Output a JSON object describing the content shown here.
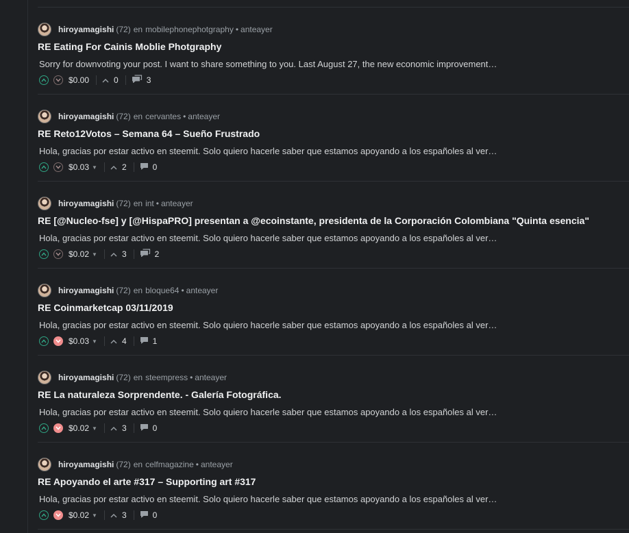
{
  "colors": {
    "background": "#1e2023",
    "upvote": "#2fa382",
    "downvote_active": "#f08d8d",
    "text": "#dfe1e3",
    "muted": "#9aa0a6"
  },
  "labels": {
    "in": "en",
    "dot": "•"
  },
  "posts": [
    {
      "author": "hiroyamagishi",
      "reputation": "(72)",
      "community": "mobilephonephotgraphy",
      "time": "anteayer",
      "title": "RE Eating For Cainis Moblie Photgraphy",
      "excerpt": "Sorry for downvoting your post. I want to share something to you. Last August 27, the new economic improvement…",
      "payout": "$0.00",
      "votes": "0",
      "comments": "3",
      "downvoted": false,
      "has_payout_caret": false,
      "comment_icon": "comments-icon"
    },
    {
      "author": "hiroyamagishi",
      "reputation": "(72)",
      "community": "cervantes",
      "time": "anteayer",
      "title": "RE Reto12Votos – Semana 64 – Sueño Frustrado",
      "excerpt": "Hola, gracias por estar activo en steemit. Solo quiero hacerle saber que estamos apoyando a los españoles al ver…",
      "payout": "$0.03",
      "votes": "2",
      "comments": "0",
      "downvoted": false,
      "has_payout_caret": true,
      "comment_icon": "comment-icon"
    },
    {
      "author": "hiroyamagishi",
      "reputation": "(72)",
      "community": "int",
      "time": "anteayer",
      "title": "RE [@Nucleo-fse] y [@HispaPRO] presentan a @ecoinstante, presidenta de la Corporación Colombiana \"Quinta esencia\"",
      "excerpt": "Hola, gracias por estar activo en steemit. Solo quiero hacerle saber que estamos apoyando a los españoles al ver…",
      "payout": "$0.02",
      "votes": "3",
      "comments": "2",
      "downvoted": false,
      "has_payout_caret": true,
      "comment_icon": "comments-icon"
    },
    {
      "author": "hiroyamagishi",
      "reputation": "(72)",
      "community": "bloque64",
      "time": "anteayer",
      "title": "RE Coinmarketcap 03/11/2019",
      "excerpt": "Hola, gracias por estar activo en steemit. Solo quiero hacerle saber que estamos apoyando a los españoles al ver…",
      "payout": "$0.03",
      "votes": "4",
      "comments": "1",
      "downvoted": true,
      "has_payout_caret": true,
      "comment_icon": "comment-icon"
    },
    {
      "author": "hiroyamagishi",
      "reputation": "(72)",
      "community": "steempress",
      "time": "anteayer",
      "title": "RE La naturaleza Sorprendente. - Galería Fotográfica.",
      "excerpt": "Hola, gracias por estar activo en steemit. Solo quiero hacerle saber que estamos apoyando a los españoles al ver…",
      "payout": "$0.02",
      "votes": "3",
      "comments": "0",
      "downvoted": true,
      "has_payout_caret": true,
      "comment_icon": "comment-icon"
    },
    {
      "author": "hiroyamagishi",
      "reputation": "(72)",
      "community": "celfmagazine",
      "time": "anteayer",
      "title": "RE Apoyando el arte #317 – Supporting art #317",
      "excerpt": "Hola, gracias por estar activo en steemit. Solo quiero hacerle saber que estamos apoyando a los españoles al ver…",
      "payout": "$0.02",
      "votes": "3",
      "comments": "0",
      "downvoted": true,
      "has_payout_caret": true,
      "comment_icon": "comment-icon"
    }
  ]
}
